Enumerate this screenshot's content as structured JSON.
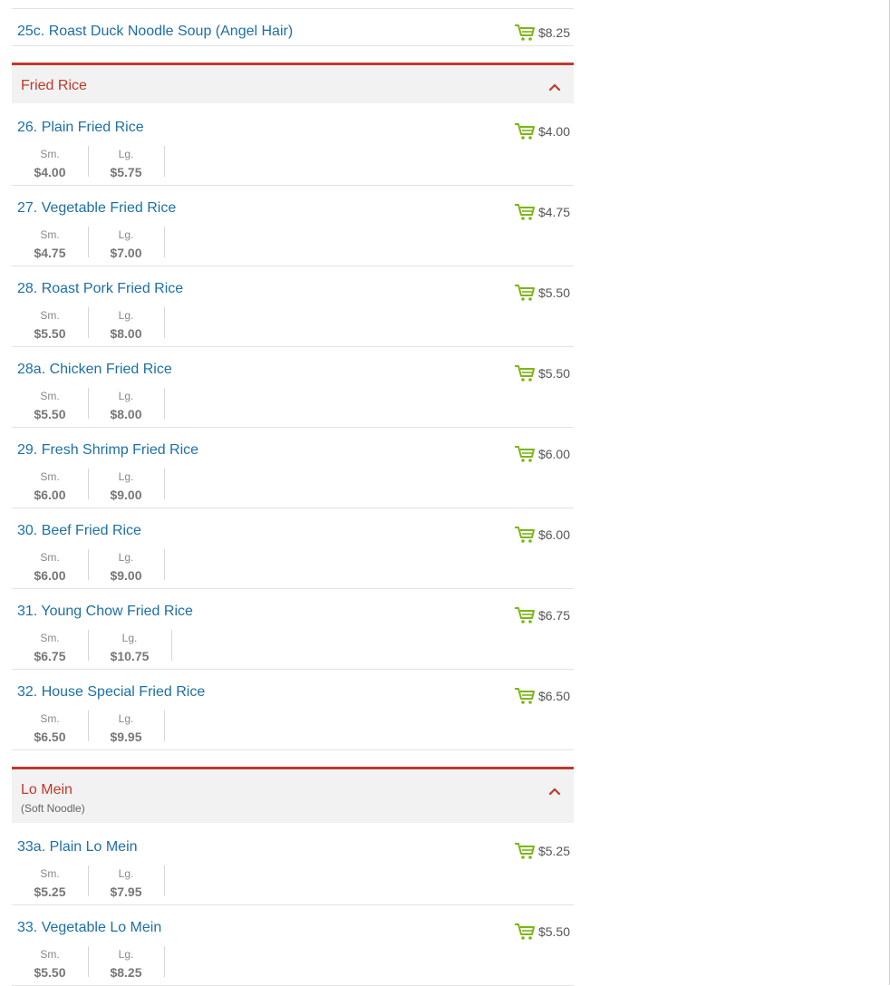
{
  "items_top": [
    {
      "name": "25c. Roast Duck Noodle Soup (Angel Hair)",
      "price": "$8.25"
    }
  ],
  "categories": [
    {
      "name": "Fried Rice",
      "subtitle": "",
      "items": [
        {
          "name": "26. Plain Fried Rice",
          "price": "$4.00",
          "sizes": [
            {
              "label": "Sm.",
              "price": "$4.00"
            },
            {
              "label": "Lg.",
              "price": "$5.75"
            }
          ]
        },
        {
          "name": "27. Vegetable Fried Rice",
          "price": "$4.75",
          "sizes": [
            {
              "label": "Sm.",
              "price": "$4.75"
            },
            {
              "label": "Lg.",
              "price": "$7.00"
            }
          ]
        },
        {
          "name": "28. Roast Pork Fried Rice",
          "price": "$5.50",
          "sizes": [
            {
              "label": "Sm.",
              "price": "$5.50"
            },
            {
              "label": "Lg.",
              "price": "$8.00"
            }
          ]
        },
        {
          "name": "28a. Chicken Fried Rice",
          "price": "$5.50",
          "sizes": [
            {
              "label": "Sm.",
              "price": "$5.50"
            },
            {
              "label": "Lg.",
              "price": "$8.00"
            }
          ]
        },
        {
          "name": "29. Fresh Shrimp Fried Rice",
          "price": "$6.00",
          "sizes": [
            {
              "label": "Sm.",
              "price": "$6.00"
            },
            {
              "label": "Lg.",
              "price": "$9.00"
            }
          ]
        },
        {
          "name": "30. Beef Fried Rice",
          "price": "$6.00",
          "sizes": [
            {
              "label": "Sm.",
              "price": "$6.00"
            },
            {
              "label": "Lg.",
              "price": "$9.00"
            }
          ]
        },
        {
          "name": "31. Young Chow Fried Rice",
          "price": "$6.75",
          "sizes": [
            {
              "label": "Sm.",
              "price": "$6.75"
            },
            {
              "label": "Lg.",
              "price": "$10.75"
            }
          ]
        },
        {
          "name": "32. House Special Fried Rice",
          "price": "$6.50",
          "sizes": [
            {
              "label": "Sm.",
              "price": "$6.50"
            },
            {
              "label": "Lg.",
              "price": "$9.95"
            }
          ]
        }
      ]
    },
    {
      "name": "Lo Mein",
      "subtitle": "(Soft Noodle)",
      "items": [
        {
          "name": "33a. Plain Lo Mein",
          "price": "$5.25",
          "sizes": [
            {
              "label": "Sm.",
              "price": "$5.25"
            },
            {
              "label": "Lg.",
              "price": "$7.95"
            }
          ]
        },
        {
          "name": "33. Vegetable Lo Mein",
          "price": "$5.50",
          "sizes": [
            {
              "label": "Sm.",
              "price": "$5.50"
            },
            {
              "label": "Lg.",
              "price": "$8.25"
            }
          ]
        }
      ]
    }
  ],
  "colors": {
    "category_accent": "#c0392b",
    "item_link": "#1d6fa5",
    "cart_icon": "#7cb518"
  },
  "icons": {
    "cart": "add-to-cart-icon",
    "collapse": "chevron-up-icon"
  }
}
